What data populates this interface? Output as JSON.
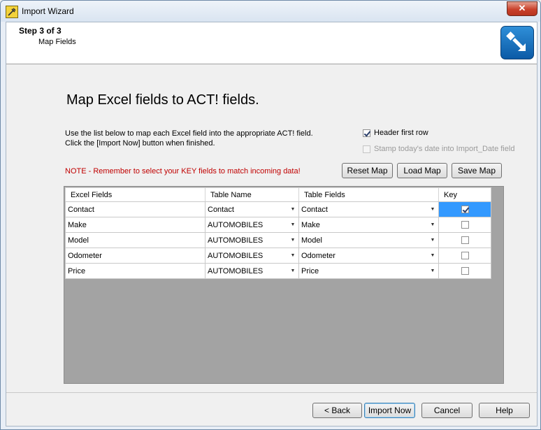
{
  "window": {
    "title": "Import Wizard",
    "close_glyph": "✕"
  },
  "header": {
    "step": "Step 3 of 3",
    "subtitle": "Map Fields",
    "icon": "import-arrow-icon"
  },
  "main": {
    "heading": "Map Excel fields to ACT! fields.",
    "instruction_line1": "Use the list below to map each Excel field into the appropriate ACT! field.",
    "instruction_line2": "Click the [Import Now] button when finished.",
    "header_first_row": {
      "label": "Header first row",
      "checked": true
    },
    "stamp_date": {
      "label": "Stamp today's date into Import_Date field",
      "checked": false,
      "enabled": false
    },
    "note": "NOTE - Remember to select your KEY fields to match incoming data!",
    "buttons": {
      "reset_map": "Reset Map",
      "load_map": "Load Map",
      "save_map": "Save Map"
    }
  },
  "grid": {
    "columns": [
      "Excel Fields",
      "Table Name",
      "Table Fields",
      "Key"
    ],
    "rows": [
      {
        "excel": "Contact",
        "table": "Contact",
        "field": "Contact",
        "key": true
      },
      {
        "excel": "Make",
        "table": "AUTOMOBILES",
        "field": "Make",
        "key": false
      },
      {
        "excel": "Model",
        "table": "AUTOMOBILES",
        "field": "Model",
        "key": false
      },
      {
        "excel": "Odometer",
        "table": "AUTOMOBILES",
        "field": "Odometer",
        "key": false
      },
      {
        "excel": "Price",
        "table": "AUTOMOBILES",
        "field": "Price",
        "key": false
      }
    ]
  },
  "footer": {
    "back": "< Back",
    "import_now": "Import Now",
    "cancel": "Cancel",
    "help": "Help"
  },
  "colors": {
    "note": "#c00000",
    "selection": "#3399ff",
    "grid_bg": "#a3a3a3"
  }
}
